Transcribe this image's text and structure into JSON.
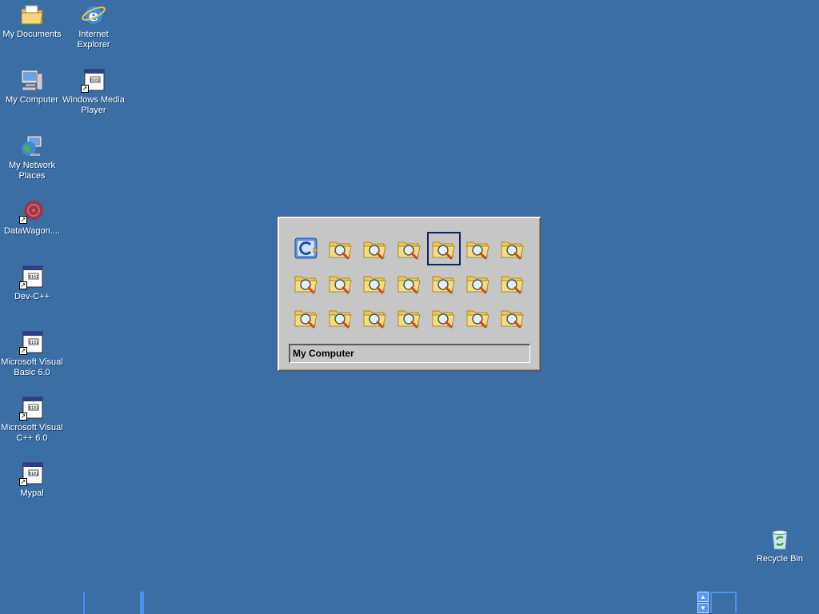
{
  "desktop": {
    "icons": [
      {
        "label": "My Documents"
      },
      {
        "label": "Internet Explorer"
      },
      {
        "label": "My Computer"
      },
      {
        "label": "Windows Media Player"
      },
      {
        "label": "My Network Places"
      },
      {
        "label": "DataWagon...."
      },
      {
        "label": "Dev-C++"
      },
      {
        "label": "Microsoft Visual Basic 6.0"
      },
      {
        "label": "Microsoft Visual C++ 6.0"
      },
      {
        "label": "Mypal"
      },
      {
        "label": "Recycle Bin"
      }
    ]
  },
  "task_switcher": {
    "selected_task_title": "My Computer",
    "task_icons": [
      "app-icon",
      "folder-search-icon",
      "folder-search-icon",
      "folder-search-icon",
      "folder-search-icon",
      "folder-search-icon",
      "folder-search-icon",
      "folder-search-icon",
      "folder-search-icon",
      "folder-search-icon",
      "folder-search-icon",
      "folder-search-icon",
      "folder-search-icon",
      "folder-search-icon",
      "folder-search-icon",
      "folder-search-icon",
      "folder-search-icon",
      "folder-search-icon",
      "folder-search-icon",
      "folder-search-icon",
      "folder-search-icon"
    ],
    "selected_index": 4
  },
  "colors": {
    "desktop_background": "#3a6ea5",
    "selection_border": "#0a246a",
    "dialog_face": "#c6c6c6"
  }
}
